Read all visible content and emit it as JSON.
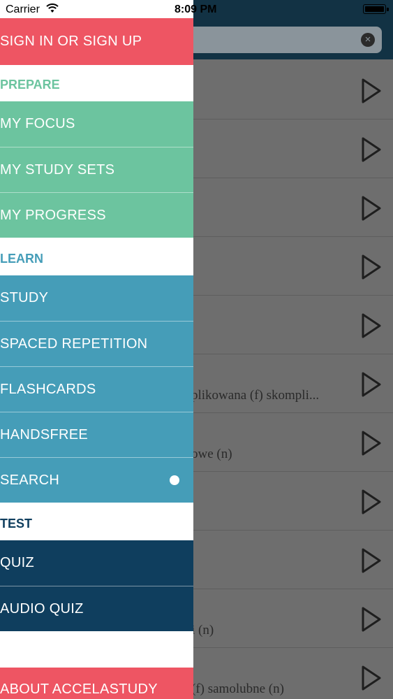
{
  "status_bar": {
    "carrier": "Carrier",
    "time": "8:09 PM"
  },
  "background": {
    "rows": [
      {
        "text": ""
      },
      {
        "text": ""
      },
      {
        "text": ""
      },
      {
        "text": ""
      },
      {
        "text": ""
      },
      {
        "text": "plikowana (f)  skompli..."
      },
      {
        "text": "owe (n)"
      },
      {
        "text": ""
      },
      {
        "text": ""
      },
      {
        "text": "i (n)"
      },
      {
        "text": "(f)  samolubne (n)"
      }
    ]
  },
  "menu": {
    "sign_in": "SIGN IN OR SIGN UP",
    "prepare_header": "PREPARE",
    "my_focus": "MY FOCUS",
    "my_study_sets": "MY STUDY SETS",
    "my_progress": "MY PROGRESS",
    "learn_header": "LEARN",
    "study": "STUDY",
    "spaced_repetition": "SPACED REPETITION",
    "flashcards": "FLASHCARDS",
    "handsfree": "HANDSFREE",
    "search": "SEARCH",
    "test_header": "TEST",
    "quiz": "QUIZ",
    "audio_quiz": "AUDIO QUIZ",
    "about": "ABOUT ACCELASTUDY"
  },
  "colors": {
    "signin": "#ee5563",
    "prepare": "#6cc49f",
    "learn": "#459db8",
    "test": "#0f3e5e",
    "prepare_header": "#6cc49f",
    "learn_header": "#459db8",
    "test_header": "#0f3e5e"
  },
  "icons": {
    "wifi": "wifi-icon",
    "battery": "battery-icon",
    "play": "play-icon",
    "clear": "clear-icon",
    "selected": "selected-dot-icon"
  }
}
